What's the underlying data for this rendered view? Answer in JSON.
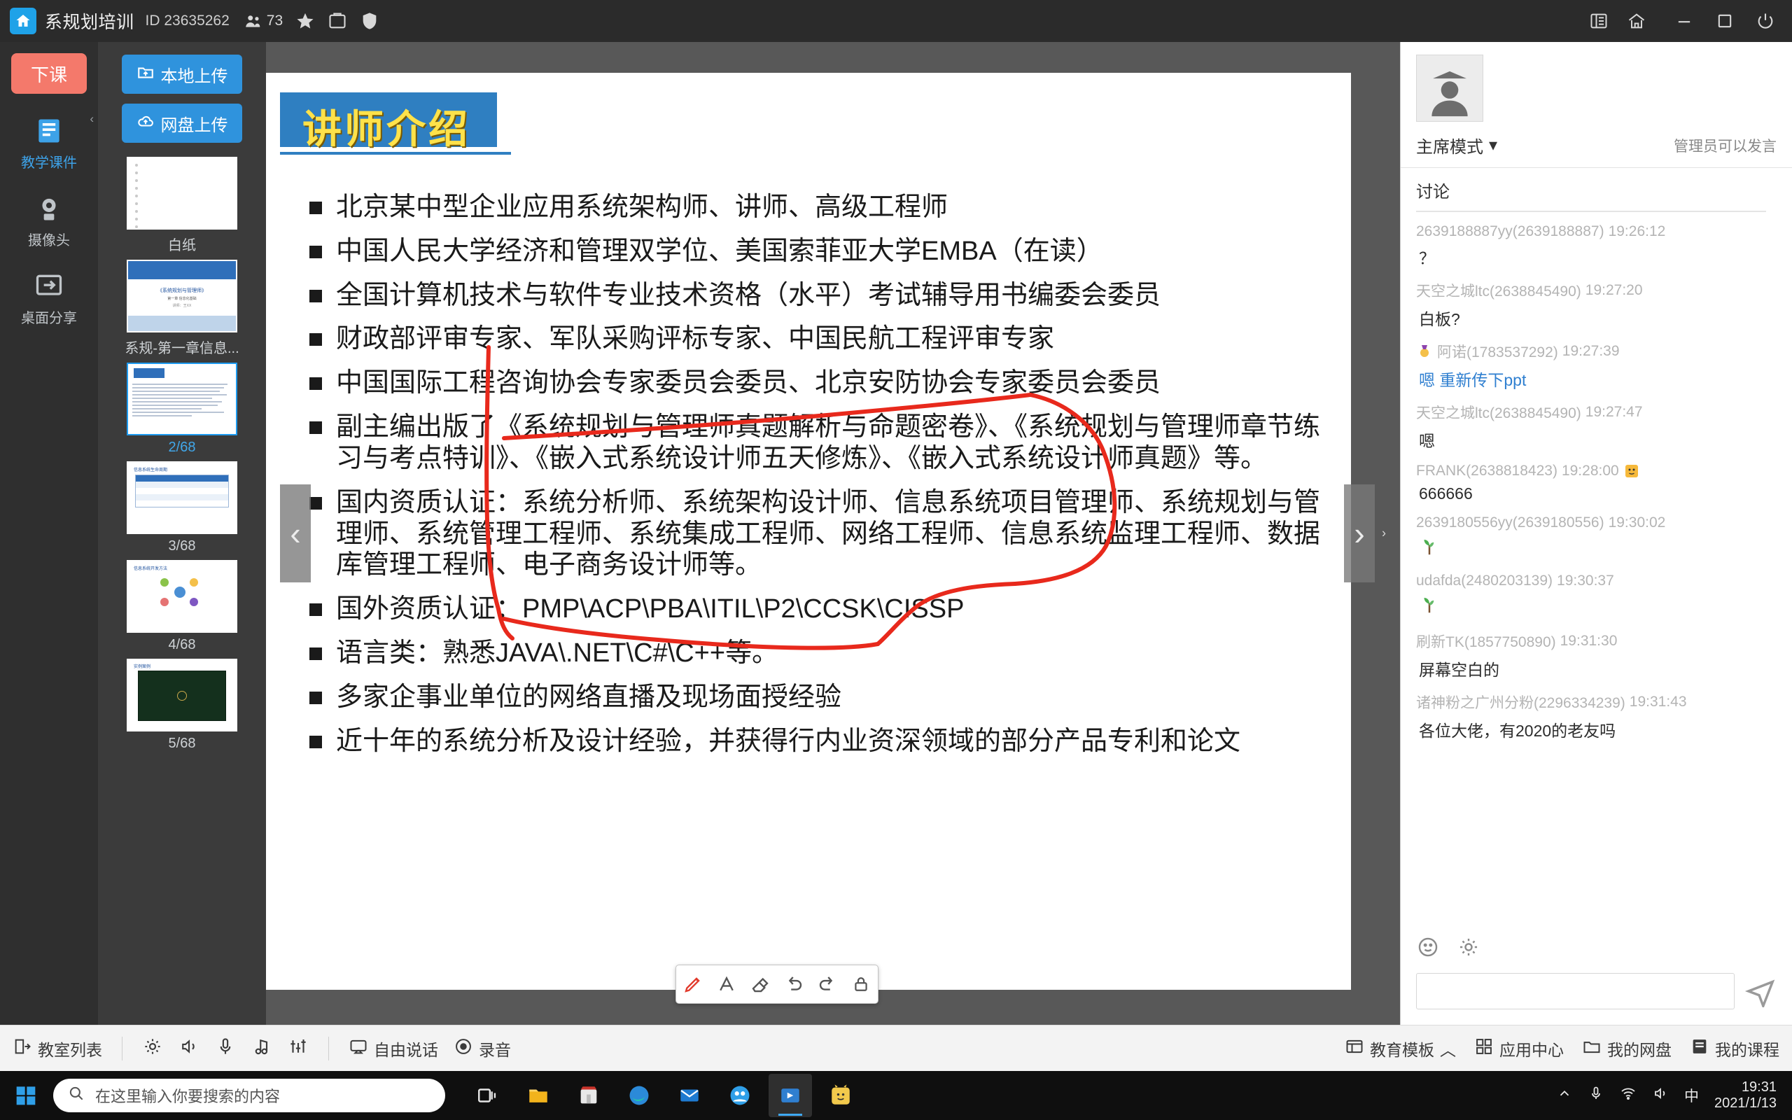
{
  "titlebar": {
    "home_icon": "home-icon",
    "course_title": "系规划培训",
    "id_label": "ID 23635262",
    "members_icon": "people-icon",
    "members_count": "73",
    "star_icon": "star-icon",
    "screenshot_icon": "screenshot-icon",
    "shield_icon": "shield-icon",
    "list_icon": "list-panel-icon",
    "house_icon": "classroom-icon",
    "minimize": "minimize-icon",
    "maximize": "maximize-icon",
    "power": "power-icon"
  },
  "rail": {
    "leave_label": "下课",
    "collapse_icon": "chevron-left-icon",
    "items": [
      {
        "label": "教学课件",
        "icon": "courseware-icon",
        "active": true
      },
      {
        "label": "摄像头",
        "icon": "camera-icon",
        "active": false
      },
      {
        "label": "桌面分享",
        "icon": "desktop-share-icon",
        "active": false
      }
    ]
  },
  "thumbs": {
    "upload_local": "本地上传",
    "upload_cloud": "网盘上传",
    "local_icon": "folder-upload-icon",
    "cloud_icon": "cloud-upload-icon",
    "items": [
      {
        "label": "白纸",
        "kind": "paper",
        "selected": false
      },
      {
        "label": "系规-第一章信息...",
        "kind": "cover",
        "selected": false
      },
      {
        "label": "2/68",
        "kind": "text",
        "selected": true
      },
      {
        "label": "3/68",
        "kind": "table",
        "selected": false
      },
      {
        "label": "4/68",
        "kind": "diagram",
        "selected": false
      },
      {
        "label": "5/68",
        "kind": "dark",
        "selected": false
      }
    ]
  },
  "slide": {
    "heading": "讲师介绍",
    "bullets": [
      "北京某中型企业应用系统架构师、讲师、高级工程师",
      "中国人民大学经济和管理双学位、美国索菲亚大学EMBA（在读）",
      "全国计算机技术与软件专业技术资格（水平）考试辅导用书编委会委员",
      "财政部评审专家、军队采购评标专家、中国民航工程评审专家",
      "中国国际工程咨询协会专家委员会委员、北京安防协会专家委员会委员",
      "副主编出版了《系统规划与管理师真题解析与命题密卷》、《系统规划与管理师章节练习与考点特训》、《嵌入式系统设计师五天修炼》、《嵌入式系统设计师真题》等。",
      "国内资质认证：系统分析师、系统架构设计师、信息系统项目管理师、系统规划与管理师、系统管理工程师、系统集成工程师、网络工程师、信息系统监理工程师、数据库管理工程师、电子商务设计师等。",
      "国外资质认证：PMP\\ACP\\PBA\\ITIL\\P2\\CCSK\\CISSP",
      "语言类：熟悉JAVA\\.NET\\C#\\C++等。",
      "多家企事业单位的网络直播及现场面授经验",
      "近十年的系统分析及设计经验，并获得行内业资深领域的部分产品专利和论文"
    ],
    "nav_prev": "‹",
    "nav_next": "›",
    "annotation_tools": [
      {
        "name": "pen-tool",
        "glyph": "pen-icon",
        "active": true
      },
      {
        "name": "text-tool",
        "glyph": "A",
        "active": false
      },
      {
        "name": "eraser-tool",
        "glyph": "eraser-icon",
        "active": false
      },
      {
        "name": "undo-tool",
        "glyph": "undo-icon",
        "active": false
      },
      {
        "name": "redo-tool",
        "glyph": "redo-icon",
        "active": false
      },
      {
        "name": "lock-tool",
        "glyph": "lock-icon",
        "active": false
      }
    ],
    "ink_color": "#e8291c"
  },
  "chat": {
    "avatar_icon": "user-avatar-icon",
    "mode_label": "主席模式",
    "mode_caret": "▾",
    "permission_note": "管理员可以发言",
    "tab_label": "讨论",
    "messages": [
      {
        "name": "2639188887yy(2639188887)",
        "time": "19:26:12",
        "text": "？",
        "link": false
      },
      {
        "name": "天空之城ltc(2638845490)",
        "time": "19:27:20",
        "text": "白板?",
        "link": false
      },
      {
        "name": "阿诺(1783537292)",
        "time": "19:27:39",
        "text": "嗯 重新传下ppt",
        "link": true,
        "badge": "medal-icon"
      },
      {
        "name": "天空之城ltc(2638845490)",
        "time": "19:27:47",
        "text": "嗯",
        "link": false
      },
      {
        "name": "FRANK(2638818423)",
        "time": "19:28:00",
        "text": "666666",
        "link": false,
        "trailing_badge": "emoji-icon"
      },
      {
        "name": "2639180556yy(2639180556)",
        "time": "19:30:02",
        "text": "emoji-plant",
        "link": false
      },
      {
        "name": "udafda(2480203139)",
        "time": "19:30:37",
        "text": "emoji-plant",
        "link": false
      },
      {
        "name": "刷新TK(1857750890)",
        "time": "19:31:30",
        "text": "屏幕空白的",
        "link": false
      },
      {
        "name": "诸神粉之广州分粉(2296334239)",
        "time": "19:31:43",
        "text": "各位大佬，有2020的老友吗",
        "link": false
      }
    ],
    "tool_icons": [
      "emoji-icon",
      "settings-gear-icon"
    ],
    "input_placeholder": "",
    "send_icon": "send-icon"
  },
  "bottombar": {
    "left_items": [
      {
        "label": "教室列表",
        "icon": "classroom-list-icon"
      }
    ],
    "middle_icons": [
      {
        "name": "settings-gear-icon"
      },
      {
        "name": "speaker-icon"
      },
      {
        "name": "microphone-icon"
      },
      {
        "name": "music-icon"
      },
      {
        "name": "equalizer-icon"
      }
    ],
    "free_speak": "自由说话",
    "free_speak_icon": "free-speak-icon",
    "record": "录音",
    "record_icon": "record-icon",
    "right_items": [
      {
        "label": "教育模板",
        "icon": "template-icon",
        "caret": "︿"
      },
      {
        "label": "应用中心",
        "icon": "apps-icon"
      },
      {
        "label": "我的网盘",
        "icon": "cloud-disk-icon"
      },
      {
        "label": "我的课程",
        "icon": "my-course-icon"
      }
    ]
  },
  "taskbar": {
    "start_icon": "windows-start-icon",
    "search_placeholder": "在这里输入你要搜索的内容",
    "search_icon": "search-icon",
    "apps": [
      {
        "name": "task-view-icon",
        "active": false
      },
      {
        "name": "file-explorer-icon",
        "active": false
      },
      {
        "name": "store-icon",
        "active": false
      },
      {
        "name": "edge-icon",
        "active": false
      },
      {
        "name": "mail-icon",
        "active": false
      },
      {
        "name": "meeting-icon",
        "active": false
      },
      {
        "name": "classin-icon",
        "active": true
      },
      {
        "name": "cat-app-icon",
        "active": false
      }
    ],
    "tray_icons": [
      "chevron-up-icon",
      "mic-tray-icon",
      "network-icon",
      "volume-icon",
      "ime-icon"
    ],
    "ime_label": "中",
    "time": "19:31",
    "date": "2021/1/13"
  },
  "colors": {
    "accent_blue": "#2f93dd",
    "leave_red": "#f4796b",
    "ink_red": "#e8291c",
    "slide_head_blue": "#2f7fc1",
    "slide_head_yellow": "#ffe24a"
  }
}
